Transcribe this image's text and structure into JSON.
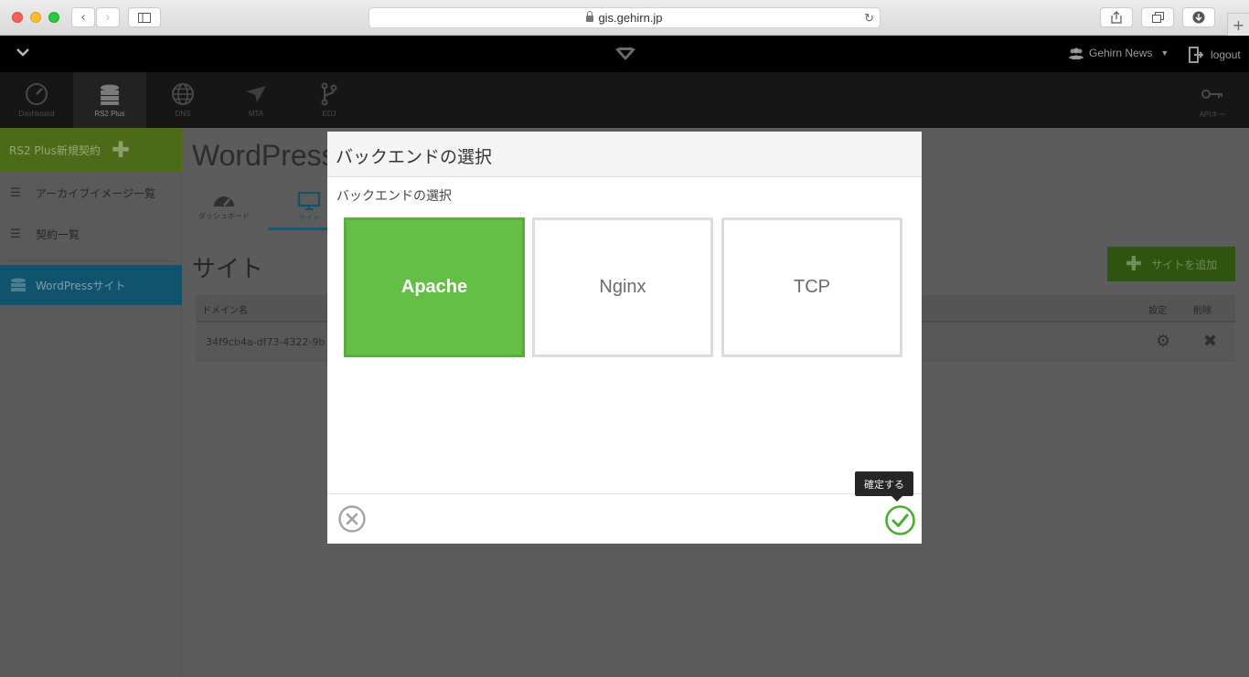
{
  "browser": {
    "url": "gis.gehirn.jp"
  },
  "header": {
    "user_menu": "Gehirn News",
    "logout": "logout"
  },
  "services": [
    {
      "label": "Dashboard"
    },
    {
      "label": "RS2 Plus"
    },
    {
      "label": "DNS"
    },
    {
      "label": "MTA"
    },
    {
      "label": "EDJ"
    },
    {
      "label": "APIキー"
    }
  ],
  "sidebar": {
    "new_contract": "RS2 Plus新規契約",
    "items": [
      {
        "label": "アーカイブイメージ一覧"
      },
      {
        "label": "契約一覧"
      }
    ],
    "active": "WordPressサイト"
  },
  "main": {
    "title": "WordPress",
    "tabs": [
      {
        "label": "ダッシュボード"
      },
      {
        "label": "サイト"
      }
    ],
    "section_title": "サイト",
    "add_button": "サイトを追加",
    "table": {
      "headers": {
        "domain": "ドメイン名",
        "settings": "設定",
        "delete": "削除"
      },
      "rows": [
        {
          "domain": "34f9cb4a-df73-4322-9b"
        }
      ]
    }
  },
  "modal": {
    "title": "バックエンドの選択",
    "subtitle": "バックエンドの選択",
    "options": [
      {
        "label": "Apache",
        "selected": true
      },
      {
        "label": "Nginx",
        "selected": false
      },
      {
        "label": "TCP",
        "selected": false
      }
    ],
    "confirm_tooltip": "確定する"
  },
  "colors": {
    "selected_option": "#65be45",
    "confirm": "#4cae35"
  }
}
